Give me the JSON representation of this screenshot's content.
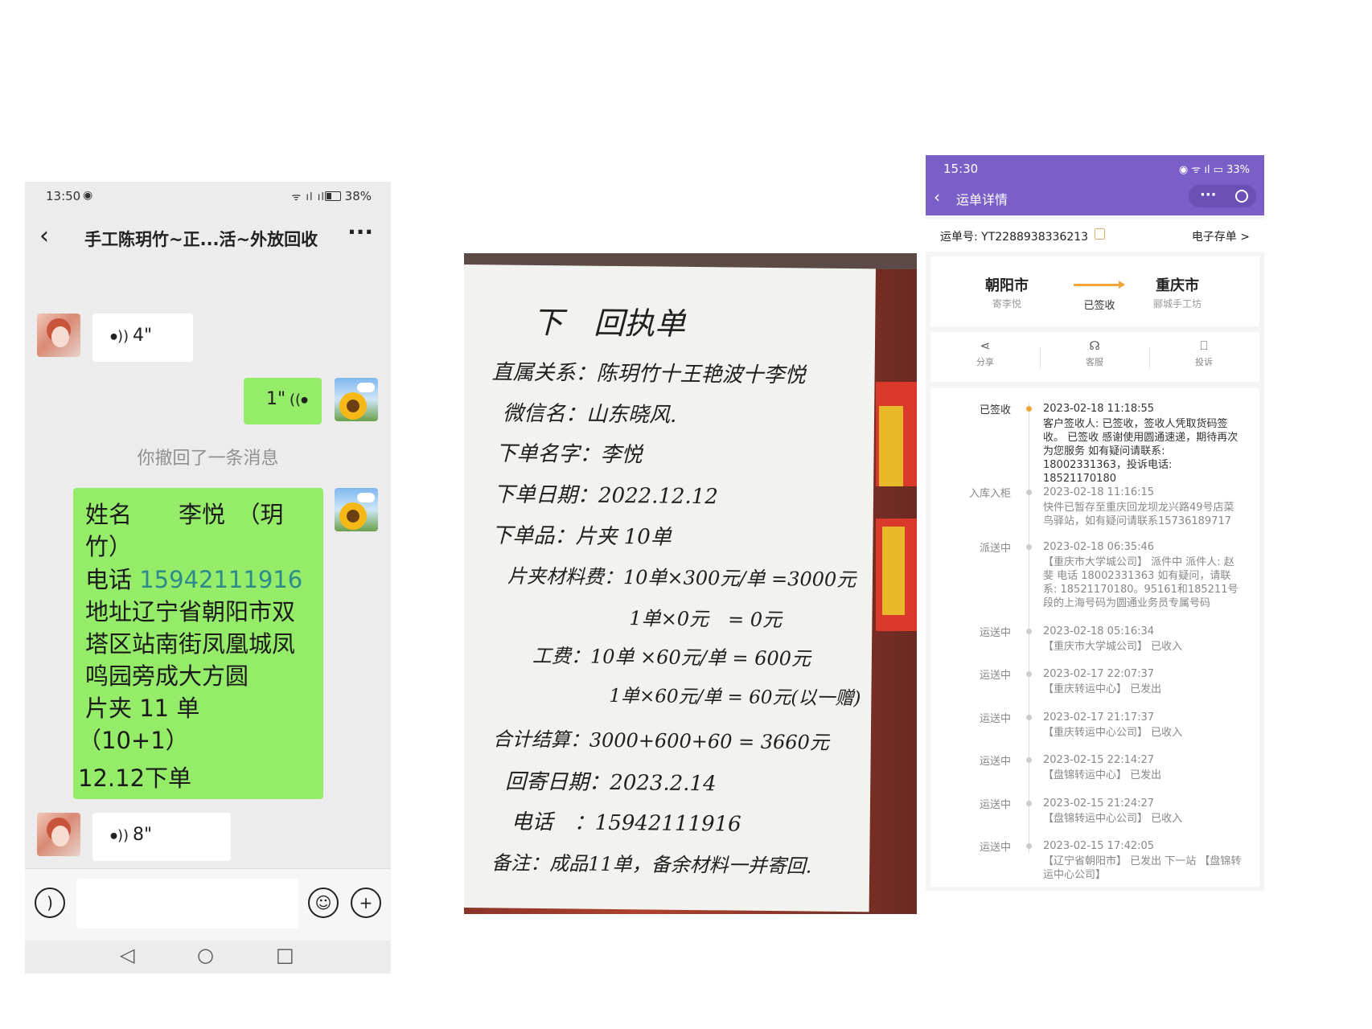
{
  "chat": {
    "status": {
      "time": "13:50",
      "battery": "38%"
    },
    "title": "手工陈玥竹~正...活~外放回收",
    "voice_in_1": "4\"",
    "voice_out_1": "1\"",
    "recalled": "你撤回了一条消息",
    "message": {
      "name_row": "姓名　　李悦　（玥",
      "name_row2": "竹）",
      "phone_label": "电话 ",
      "phone": "15942111916",
      "addr1": "地址辽宁省朝阳市双",
      "addr2": "塔区站南街凤凰城凤",
      "addr3": "鸣园旁成大方圆",
      "item": "片夹 11 单",
      "qty": "（10+1）",
      "date": "12.12下单"
    },
    "voice_in_2": "8\""
  },
  "note": {
    "title": "下　回执单",
    "lines": [
      "直属关系：陈玥竹十王艳波十李悦",
      "微信名：山东晓风.",
      "下单名字：李悦",
      "下单日期：2022.12.12",
      "下单品：片夹 10单",
      "片夹材料费：10单×300元/单 =3000元",
      "1单×0元　= 0元",
      "工费：10单 ×60元/单 = 600元",
      "1单×60元/单 = 60元(以一赠)",
      "合计结算：3000+600+60 = 3660元",
      "回寄日期：2023.2.14",
      "电话　：15942111916",
      "备注：成品11单，备余材料一并寄回."
    ]
  },
  "app": {
    "status": {
      "time": "15:30",
      "battery": "33%"
    },
    "title": "运单详情",
    "waybill_no": "运单号: YT2288938336213",
    "e_receipt": "电子存单 >",
    "from_city": "朝阳市",
    "from_sub": "寄李悦",
    "to_city": "重庆市",
    "to_sub": "郦城手工坊",
    "status_text": "已签收",
    "actions": [
      "分享",
      "客服",
      "投诉"
    ],
    "events": [
      {
        "status": "已签收",
        "time": "2023-02-18 11:18:55",
        "desc": "客户签收人: 已签收，签收人凭取货码签收。 已签收 感谢使用圆通速递，期待再次为您服务 如有疑问请联系: 18002331363，投诉电话: 18521170180"
      },
      {
        "status": "入库入柜",
        "time": "2023-02-18 11:16:15",
        "desc": "快件已暂存至重庆回龙坝龙兴路49号店菜鸟驿站，如有疑问请联系15736189717"
      },
      {
        "status": "派送中",
        "time": "2023-02-18 06:35:46",
        "desc": "【重庆市大学城公司】 派件中 派件人: 赵斐 电话 18002331363 如有疑问，请联系: 18521170180。95161和185211号段的上海号码为圆通业务员专属号码"
      },
      {
        "status": "运送中",
        "time": "2023-02-18 05:16:34",
        "desc": "【重庆市大学城公司】 已收入"
      },
      {
        "status": "运送中",
        "time": "2023-02-17 22:07:37",
        "desc": "【重庆转运中心】 已发出"
      },
      {
        "status": "运送中",
        "time": "2023-02-17 21:17:37",
        "desc": "【重庆转运中心公司】 已收入"
      },
      {
        "status": "运送中",
        "time": "2023-02-15 22:14:27",
        "desc": "【盘锦转运中心】 已发出"
      },
      {
        "status": "运送中",
        "time": "2023-02-15 21:24:27",
        "desc": "【盘锦转运中心公司】 已收入"
      },
      {
        "status": "运送中",
        "time": "2023-02-15 17:42:05",
        "desc": "【辽宁省朝阳市】 已发出 下一站 【盘锦转运中心公司】"
      }
    ]
  },
  "colors": {
    "chat_bubble": "#95ec69",
    "app_header": "#7b5fc9",
    "accent_orange": "#f0a53a"
  }
}
